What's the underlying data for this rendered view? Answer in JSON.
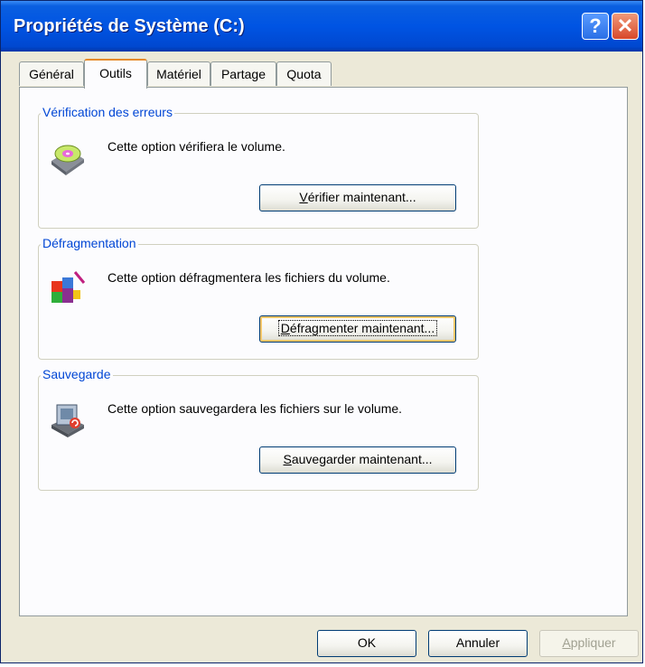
{
  "window": {
    "title": "Propriétés de Système (C:)",
    "help_symbol": "?",
    "close_symbol": "✕"
  },
  "tabs": [
    {
      "label": "Général",
      "active": false
    },
    {
      "label": "Outils",
      "active": true
    },
    {
      "label": "Matériel",
      "active": false
    },
    {
      "label": "Partage",
      "active": false
    },
    {
      "label": "Quota",
      "active": false
    }
  ],
  "groups": {
    "errors": {
      "legend": "Vérification des erreurs",
      "description": "Cette option vérifiera le volume.",
      "button_accel": "V",
      "button_rest": "érifier maintenant...",
      "icon": "disk-check-icon"
    },
    "defrag": {
      "legend": "Défragmentation",
      "description": "Cette option défragmentera les fichiers du volume.",
      "button_accel": "D",
      "button_rest": "éfragmenter maintenant...",
      "icon": "defrag-icon"
    },
    "backup": {
      "legend": "Sauvegarde",
      "description": "Cette option sauvegardera les fichiers sur le volume.",
      "button_accel": "S",
      "button_rest": "auvegarder maintenant...",
      "icon": "backup-icon"
    }
  },
  "footer": {
    "ok": "OK",
    "cancel": "Annuler",
    "apply_accel": "A",
    "apply_rest": "ppliquer"
  },
  "colors": {
    "title_bar": "#0054e3",
    "legend_text": "#0046d5",
    "active_tab_accent": "#e68b2c"
  }
}
